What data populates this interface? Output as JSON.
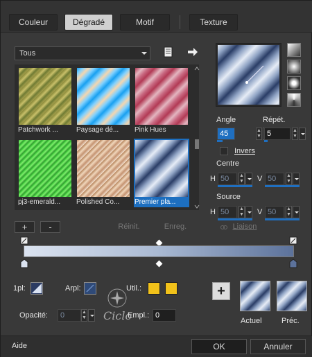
{
  "tabs": [
    {
      "label": "Couleur",
      "active": false
    },
    {
      "label": "Dégradé",
      "active": true
    },
    {
      "label": "Motif",
      "active": false
    },
    {
      "label": "Texture",
      "active": false
    }
  ],
  "category_select": {
    "value": "Tous"
  },
  "icons": {
    "library": "book-icon",
    "arrow": "arrow-right-icon"
  },
  "gradients": [
    {
      "label": "Patchwork ...",
      "selected": false
    },
    {
      "label": "Paysage dé...",
      "selected": false
    },
    {
      "label": "Pink Hues",
      "selected": false
    },
    {
      "label": "pj3-emerald...",
      "selected": false
    },
    {
      "label": "Polished Co...",
      "selected": false
    },
    {
      "label": "Premier pla...",
      "selected": true
    }
  ],
  "angle": {
    "label": "Angle",
    "value": "45"
  },
  "repeat": {
    "label": "Répét.",
    "value": "5"
  },
  "invert": {
    "label": "Invers",
    "checked": false
  },
  "center": {
    "label": "Centre",
    "h_label": "H",
    "h_value": "50",
    "v_label": "V",
    "v_value": "50"
  },
  "source": {
    "label": "Source",
    "h_label": "H",
    "h_value": "50",
    "v_label": "V",
    "v_value": "50"
  },
  "gradient_buttons": {
    "add": "+",
    "remove": "-",
    "reset": "Réinit.",
    "save": "Enreg.",
    "link": "Liaison"
  },
  "stops": {
    "first_color": "#dbe3f0",
    "last_color": "#5c729b"
  },
  "params": {
    "point_label": "1pl:",
    "arp_label": "Arpl:",
    "util_label": "Util.:",
    "opacity_label": "Opacité:",
    "opacity_value": "0",
    "empl_label": "Empl.:",
    "empl_value": "0",
    "util_color_a": "#f2c21a",
    "util_color_b": "#f2c21a"
  },
  "compare": {
    "current_label": "Actuel",
    "previous_label": "Préc."
  },
  "watermark": "Ciclo",
  "footer": {
    "help": "Aide",
    "ok": "OK",
    "cancel": "Annuler"
  }
}
